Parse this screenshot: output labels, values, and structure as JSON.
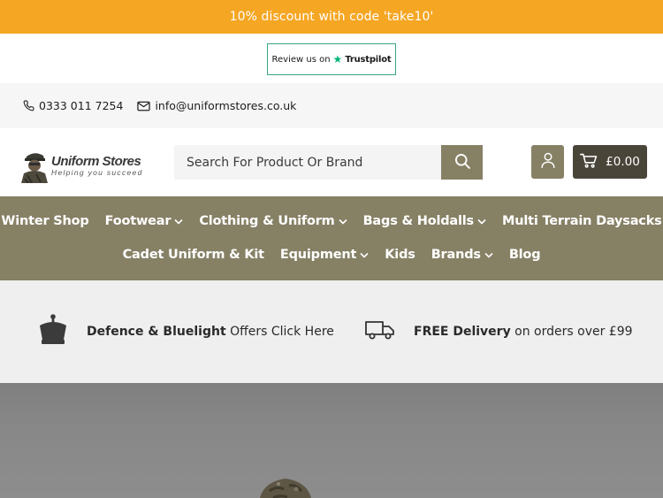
{
  "promo": {
    "text": "10% discount with code 'take10'"
  },
  "trustpilot": {
    "prefix": "Review us on",
    "brand": "Trustpilot"
  },
  "contact": {
    "phone": "0333 011 7254",
    "email": "info@uniformstores.co.uk"
  },
  "logo": {
    "title": "Uniform Stores",
    "tagline": "Helping you succeed"
  },
  "search": {
    "placeholder": "Search For Product Or Brand",
    "value": ""
  },
  "cart": {
    "total": "£0.00"
  },
  "nav": {
    "row1": [
      {
        "label": "Winter Shop",
        "has_dropdown": false
      },
      {
        "label": "Footwear",
        "has_dropdown": true
      },
      {
        "label": "Clothing & Uniform",
        "has_dropdown": true
      },
      {
        "label": "Bags & Holdalls",
        "has_dropdown": true
      },
      {
        "label": "Multi Terrain Daysacks",
        "has_dropdown": false
      }
    ],
    "row2": [
      {
        "label": "Cadet Uniform & Kit",
        "has_dropdown": false
      },
      {
        "label": "Equipment",
        "has_dropdown": true
      },
      {
        "label": "Kids",
        "has_dropdown": false
      },
      {
        "label": "Brands",
        "has_dropdown": true
      },
      {
        "label": "Blog",
        "has_dropdown": false
      }
    ]
  },
  "offers": {
    "defence": {
      "bold": "Defence & Bluelight",
      "rest": " Offers Click Here",
      "icon": "crown-icon"
    },
    "delivery": {
      "bold": "FREE Delivery",
      "rest": " on orders over £99",
      "icon": "delivery-truck-icon"
    }
  },
  "colors": {
    "promo": "#f5a623",
    "brand_khaki": "#868065",
    "cart_dark": "#4a4539",
    "offers_bg": "#efefef",
    "trustpilot_green": "#00b67a"
  }
}
